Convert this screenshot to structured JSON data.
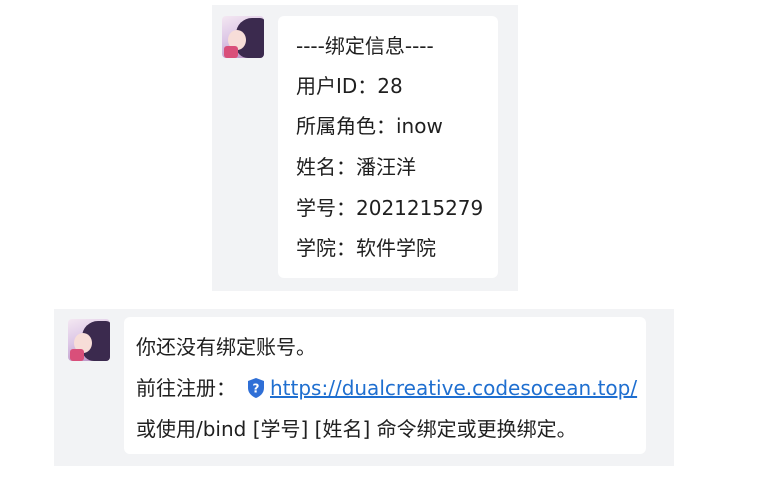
{
  "message1": {
    "lines": [
      "----绑定信息----",
      "用户ID：28",
      "所属角色：inow",
      "姓名：潘汪洋",
      "学号：2021215279",
      "学院：软件学院"
    ]
  },
  "message2": {
    "line1": "你还没有绑定账号。",
    "line2_prefix": "前往注册：",
    "link_icon": "shield-question-icon",
    "link_url": "https://dualcreative.codesocean.top/",
    "line3": "或使用/bind [学号] [姓名] 命令绑定或更换绑定。"
  },
  "colors": {
    "panel_bg": "#f2f3f5",
    "bubble_bg": "#ffffff",
    "link": "#1f6fd0"
  }
}
